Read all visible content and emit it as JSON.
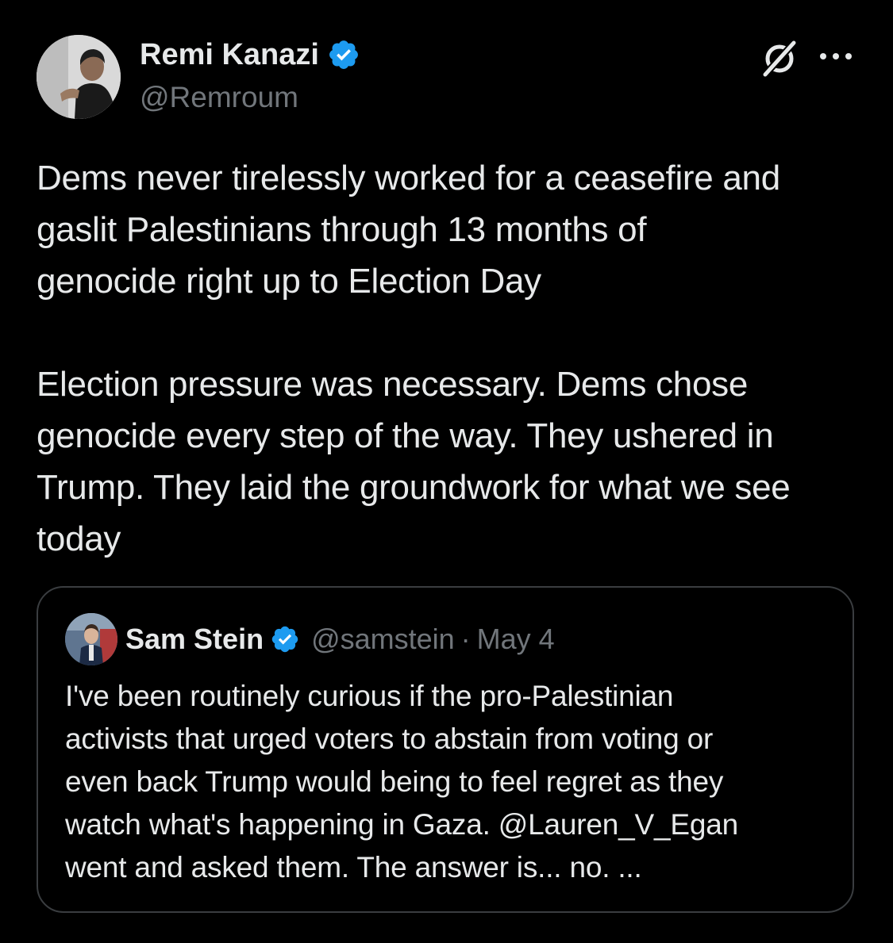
{
  "author": {
    "name": "Remi Kanazi",
    "handle": "@Remroum",
    "avatar_icon": "profile-photo",
    "verified_icon": "verified-badge-icon"
  },
  "header_actions": {
    "grok_icon": "grok-icon",
    "more_icon": "more-options-icon"
  },
  "tweet": {
    "paragraph_1": "Dems never tirelessly worked for a ceasefire and\ngaslit Palestinians through 13 months of\ngenocide right up to Election Day",
    "paragraph_2": "Election pressure was necessary. Dems chose\ngenocide every step of the way. They ushered in\nTrump. They laid the groundwork for what we see\ntoday"
  },
  "quoted_tweet": {
    "name": "Sam Stein",
    "handle": "@samstein",
    "separator": "·",
    "date": "May 4",
    "text_line_1": "I've been routinely curious if the pro-Palestinian",
    "text_line_2": "activists that urged voters to abstain from voting or",
    "text_line_3": "even back Trump would being to feel regret as they",
    "text_line_4_prefix": "watch what's happening in Gaza. ",
    "text_line_4_mention": "@Lauren_V_Egan",
    "text_line_5": "went and asked them. The answer is... no. ..."
  },
  "colors": {
    "background": "#000000",
    "text_primary": "#e7e9ea",
    "text_secondary": "#71767b",
    "verified_blue": "#1d9bf0",
    "card_border": "#3a3d40"
  }
}
